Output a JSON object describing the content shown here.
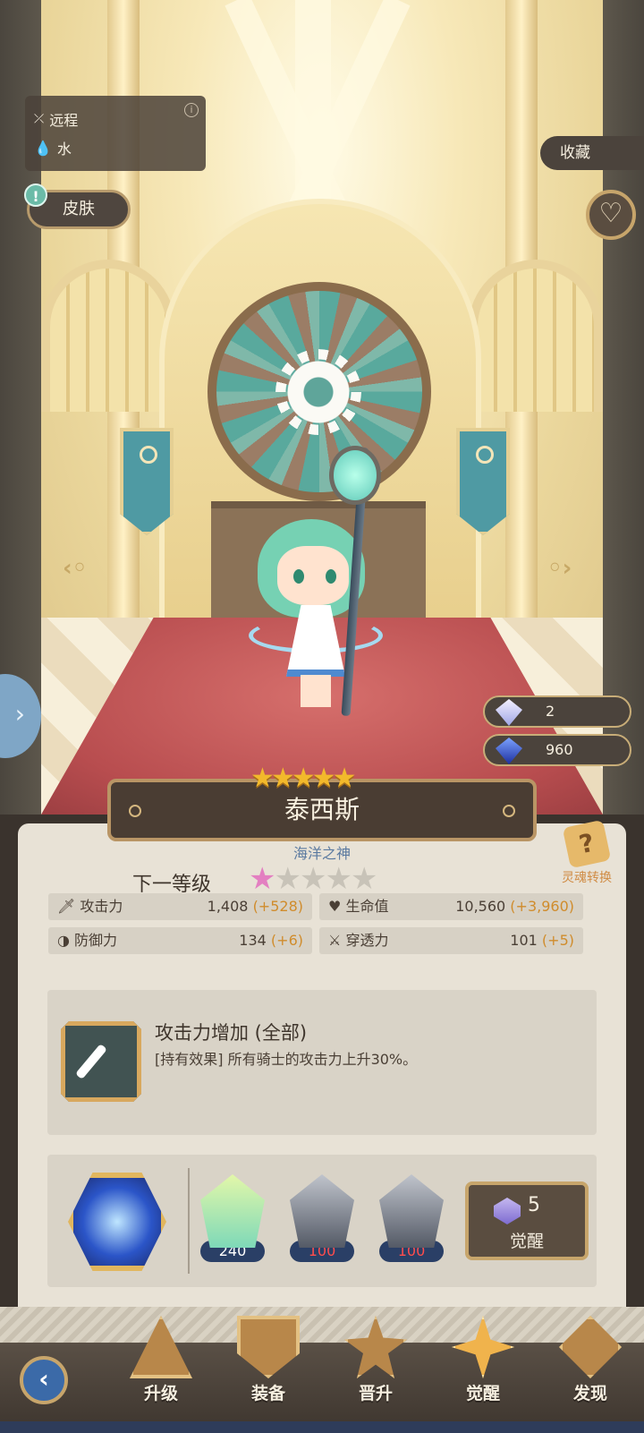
{
  "info": {
    "attack_type": "远程",
    "element": "水",
    "info_icon": "info-icon"
  },
  "skin_label": "皮肤",
  "collect_label": "收藏",
  "currency": {
    "crystal": "2",
    "gem": "960"
  },
  "hero": {
    "star_count": 5,
    "name": "泰西斯",
    "title": "海洋之神"
  },
  "next_level": {
    "label": "下一等级",
    "stars_filled": 1,
    "stars_total": 5
  },
  "spirit": {
    "label": "灵魂转换",
    "icon": "?"
  },
  "stats": [
    {
      "icon": "sword-icon",
      "label": "攻击力",
      "value": "1,408",
      "bonus": "(+528)"
    },
    {
      "icon": "heart-icon",
      "label": "生命值",
      "value": "10,560",
      "bonus": "(+3,960)"
    },
    {
      "icon": "shield-icon",
      "label": "防御力",
      "value": "134",
      "bonus": "(+6)"
    },
    {
      "icon": "pierce-icon",
      "label": "穿透力",
      "value": "101",
      "bonus": "(+5)"
    }
  ],
  "bonus": {
    "title": "攻击力增加 (全部)",
    "desc": "[持有效果] 所有骑士的攻击力上升30%。"
  },
  "materials": [
    {
      "count": "240",
      "kind": "hero-shard"
    },
    {
      "count": "100",
      "kind": "water-stone"
    },
    {
      "count": "100",
      "kind": "water-stone"
    }
  ],
  "awaken": {
    "cost": "5",
    "label": "觉醒"
  },
  "nav": [
    {
      "label": "升级"
    },
    {
      "label": "装备"
    },
    {
      "label": "晋升"
    },
    {
      "label": "觉醒"
    },
    {
      "label": "发现"
    }
  ]
}
